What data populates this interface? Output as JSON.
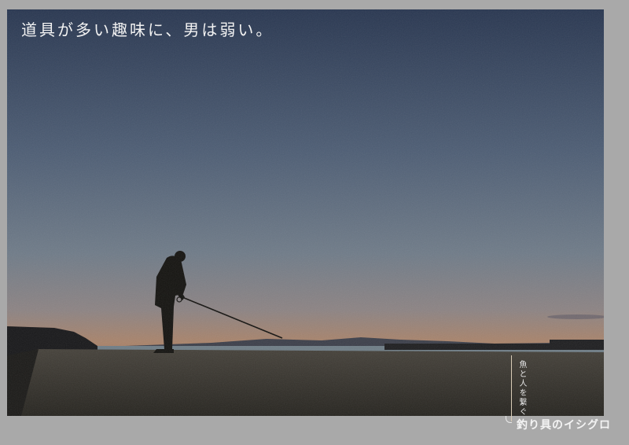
{
  "headline": "道具が多い趣味に、男は弱い。",
  "tagline": "魚と人を繋ぐ",
  "store_name": "釣り具のイシグロ",
  "store_info": "",
  "colors": {
    "sky_top": "#2c3a52",
    "sky_mid": "#6e7d8c",
    "horizon_glow": "#b08062",
    "sea": "#6f7d86",
    "silhouette": "#141310",
    "seawall": "#3b3731",
    "border": "#a9a9a9",
    "accent_line": "#d8cbb6"
  }
}
